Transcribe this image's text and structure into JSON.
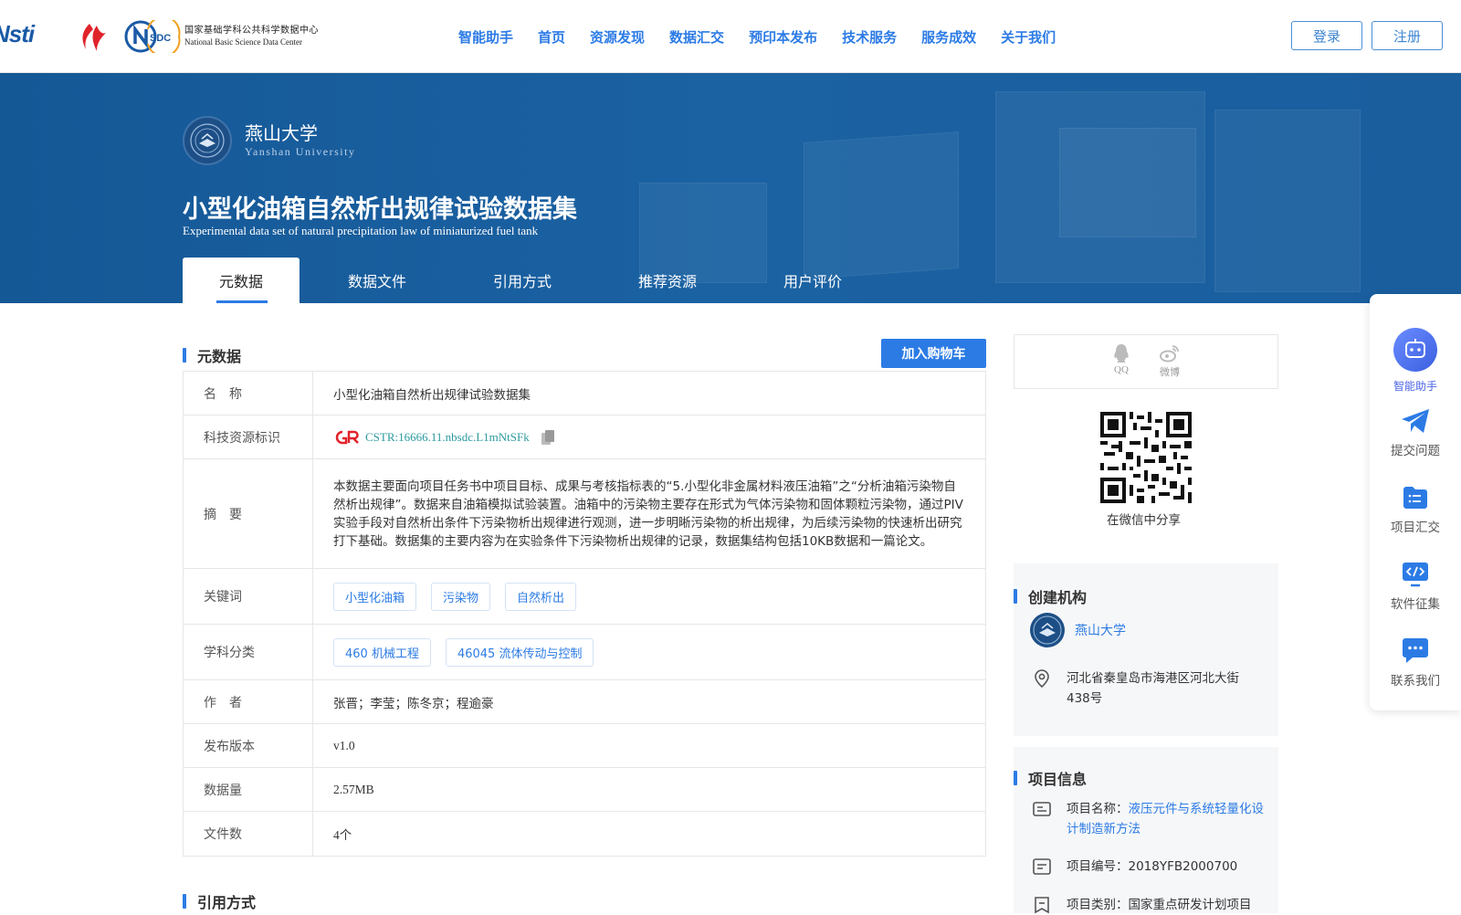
{
  "header": {
    "logo_cstr": "Nsti",
    "logo_nsdc": "NSDC",
    "nsdc_cn": "国家基础学科公共科学数据中心",
    "nsdc_en": "National Basic Science Data Center",
    "nav": [
      "智能助手",
      "首页",
      "资源发现",
      "数据汇交",
      "预印本发布",
      "技术服务",
      "服务成效",
      "关于我们"
    ],
    "login": "登录",
    "register": "注册"
  },
  "banner": {
    "org_name": "燕山大学",
    "org_en": "Yanshan University",
    "title": "小型化油箱自然析出规律试验数据集",
    "title_en": "Experimental data set of natural precipitation law of miniaturized fuel tank",
    "tabs": [
      "元数据",
      "数据文件",
      "引用方式",
      "推荐资源",
      "用户评价"
    ]
  },
  "metadata": {
    "section_title": "元数据",
    "cart_button": "加入购物车",
    "rows": {
      "name_key": "名　称",
      "name_val": "小型化油箱自然析出规律试验数据集",
      "cstr_key": "科技资源标识",
      "cstr_val": "CSTR:16666.11.nbsdc.L1mNtSFk",
      "abstract_key": "摘　要",
      "abstract_val": "本数据主要面向项目任务书中项目目标、成果与考核指标表的“5.小型化非金属材料液压油箱”之“分析油箱污染物自然析出规律”。数据来自油箱模拟试验装置。油箱中的污染物主要存在形式为气体污染物和固体颗粒污染物，通过PIV实验手段对自然析出条件下污染物析出规律进行观测，进一步明晰污染物的析出规律，为后续污染物的快速析出研究打下基础。数据集的主要内容为在实验条件下污染物析出规律的记录，数据集结构包括10KB数据和一篇论文。",
      "keywords_key": "关键词",
      "keywords": [
        "小型化油箱",
        "污染物",
        "自然析出"
      ],
      "subject_key": "学科分类",
      "subjects": [
        "460 机械工程",
        "46045 流体传动与控制"
      ],
      "author_key": "作　者",
      "author_val": "张晋；李莹；陈冬京；程逾豪",
      "version_key": "发布版本",
      "version_val": "v1.0",
      "size_key": "数据量",
      "size_val": "2.57MB",
      "files_key": "文件数",
      "files_val": "4个"
    }
  },
  "citation": {
    "section_title": "引用方式"
  },
  "share": {
    "qq": "QQ",
    "weibo": "微博",
    "wechat_caption": "在微信中分享"
  },
  "creator": {
    "title": "创建机构",
    "org": "燕山大学",
    "address": "河北省秦皇岛市海港区河北大街438号"
  },
  "project": {
    "title": "项目信息",
    "name_label": "项目名称：",
    "name_val": "液压元件与系统轻量化设计制造新方法",
    "code_label": "项目编号：",
    "code_val": "2018YFB2000700",
    "type_label": "项目类别：",
    "type_val": "国家重点研发计划项目"
  },
  "float_bar": [
    "智能助手",
    "提交问题",
    "项目汇交",
    "软件征集",
    "联系我们"
  ],
  "colors": {
    "accent": "#2c7be5",
    "banner": "#1b62a3",
    "cstr": "#2b9aa0"
  }
}
